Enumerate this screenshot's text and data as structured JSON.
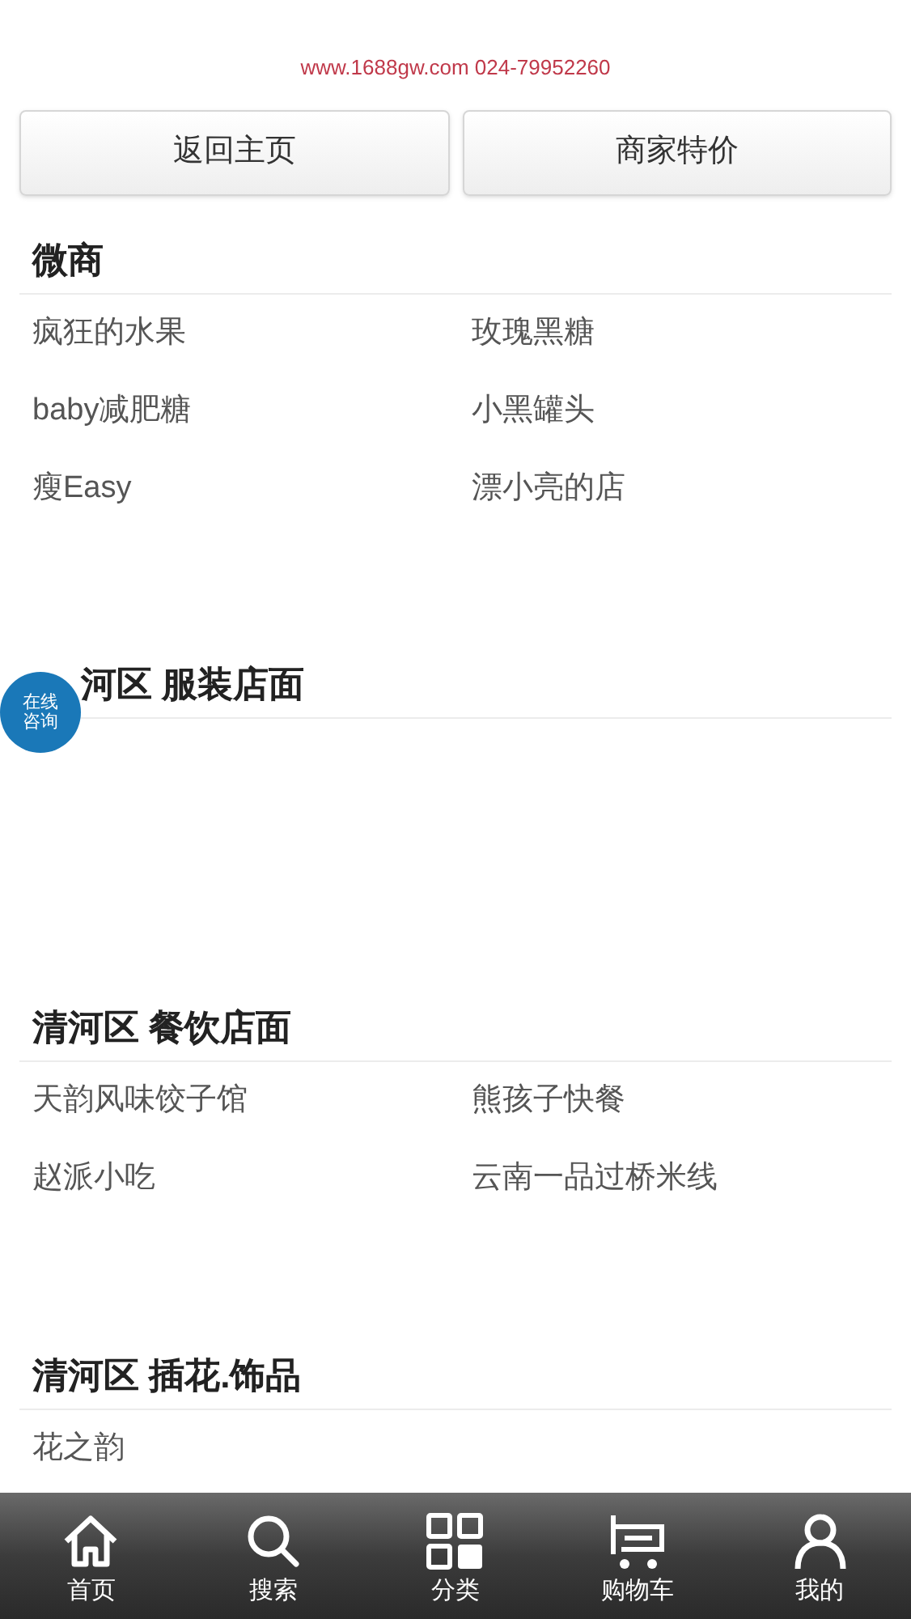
{
  "site_line": "www.1688gw.com 024-79952260",
  "buttons": [
    "返回主页",
    "商家特价"
  ],
  "sections": [
    {
      "title": "微商",
      "items": [
        "疯狂的水果",
        "玫瑰黑糖",
        "baby减肥糖",
        "小黑罐头",
        "瘦Easy",
        "漂小亮的店"
      ]
    },
    {
      "title": "河区 服装店面"
    },
    {
      "title": "清河区 餐饮店面",
      "items": [
        "天韵风味饺子馆",
        "熊孩子快餐",
        "赵派小吃",
        "云南一品过桥米线"
      ]
    },
    {
      "title": "清河区 插花.饰品",
      "items": [
        "花之韵"
      ]
    }
  ],
  "consult_badge": [
    "在线",
    "咨询"
  ],
  "bottom_nav": [
    {
      "label": "首页"
    },
    {
      "label": "搜索"
    },
    {
      "label": "分类"
    },
    {
      "label": "购物车"
    },
    {
      "label": "我的"
    }
  ]
}
